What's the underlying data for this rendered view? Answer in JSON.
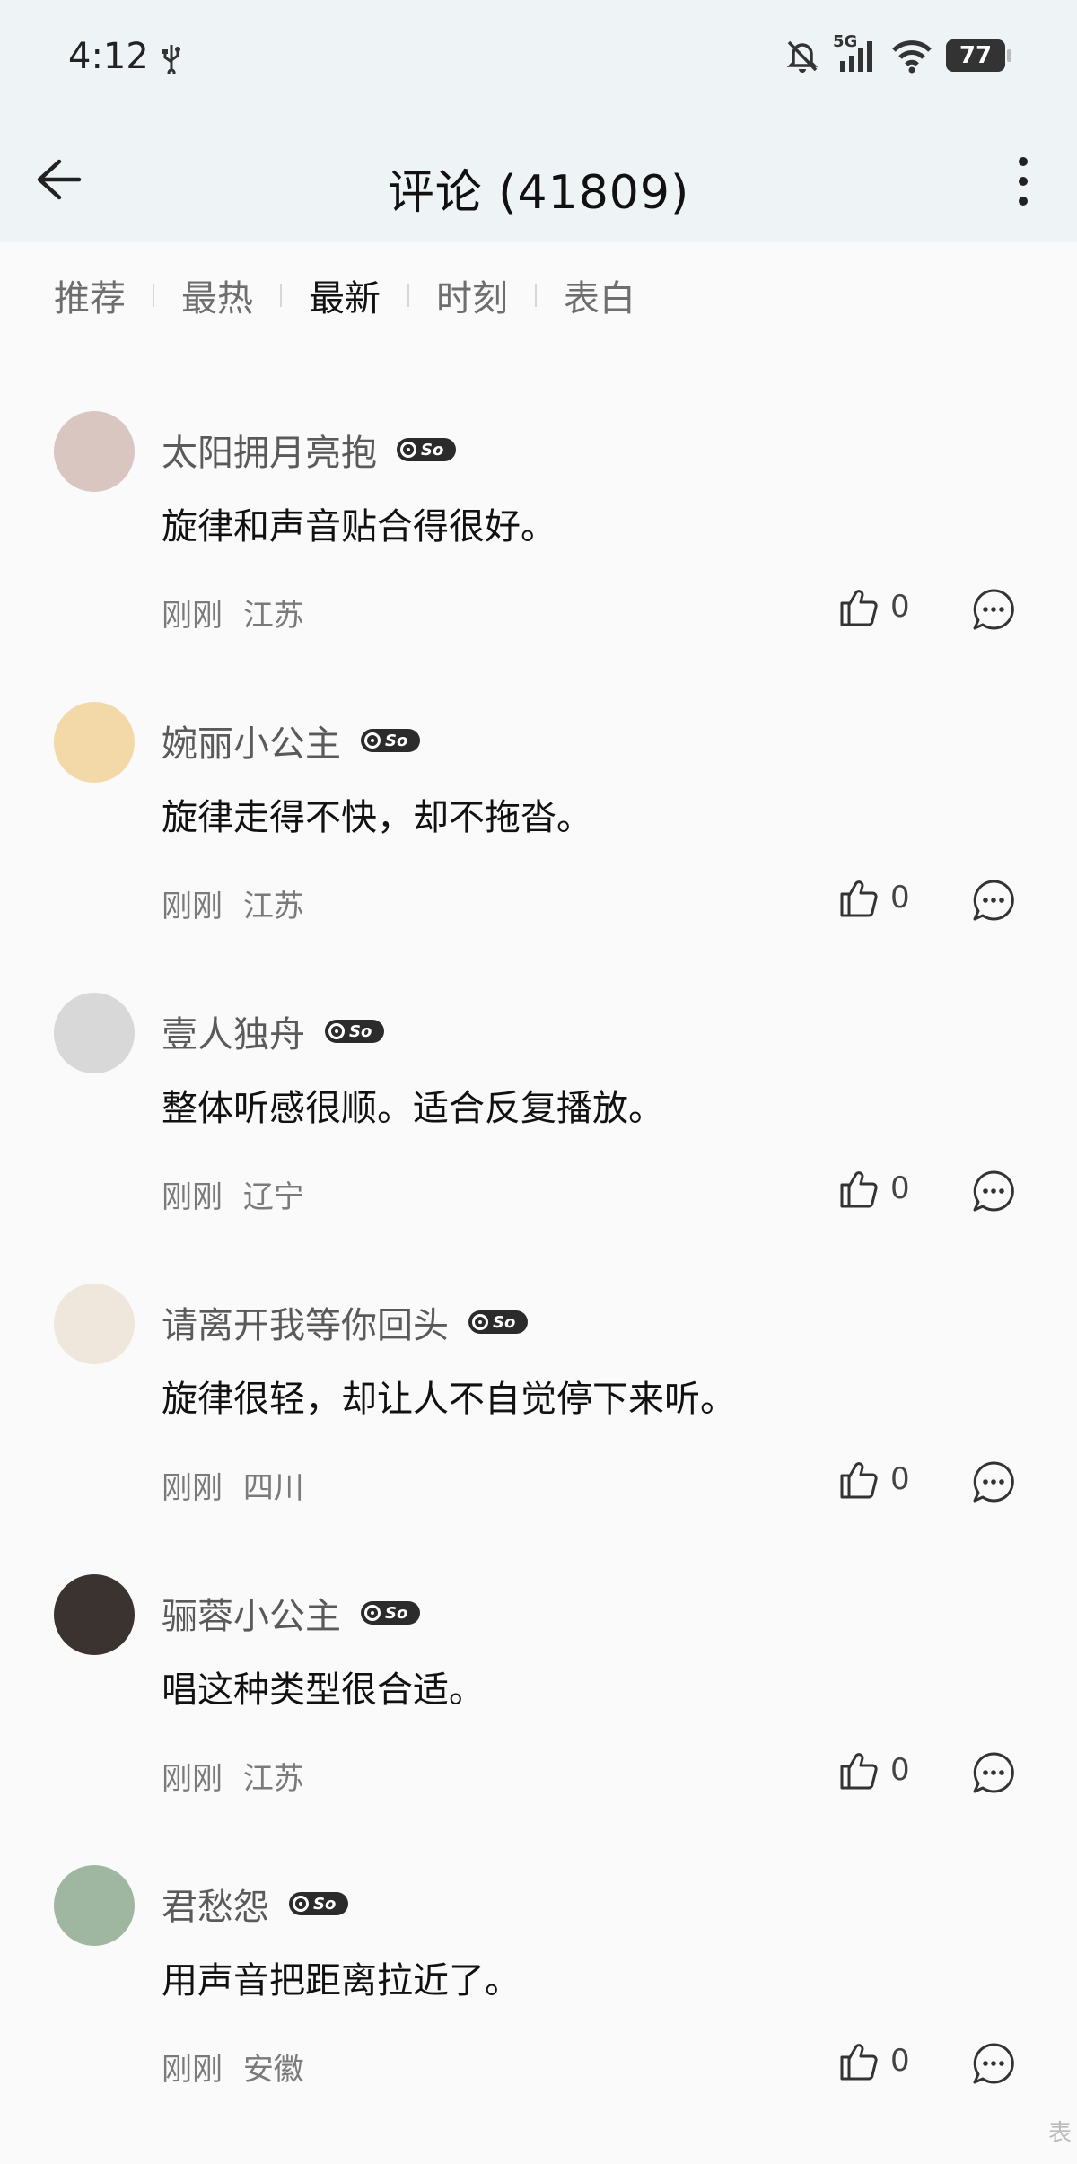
{
  "status_bar": {
    "time": "4:12",
    "network": "5G",
    "battery": "77"
  },
  "header": {
    "title": "评论 (41809)"
  },
  "tabs": [
    {
      "label": "推荐",
      "active": false
    },
    {
      "label": "最热",
      "active": false
    },
    {
      "label": "最新",
      "active": true
    },
    {
      "label": "时刻",
      "active": false
    },
    {
      "label": "表白",
      "active": false
    }
  ],
  "badge_label": "So",
  "comments": [
    {
      "user": "太阳拥月亮抱",
      "text": "旋律和声音贴合得很好。",
      "time": "刚刚",
      "location": "江苏",
      "likes": "0",
      "avatar_color": "#d9c6c0"
    },
    {
      "user": "婉丽小公主",
      "text": "旋律走得不快，却不拖沓。",
      "time": "刚刚",
      "location": "江苏",
      "likes": "0",
      "avatar_color": "#f3d8a8"
    },
    {
      "user": "壹人独舟",
      "text": "整体听感很顺。适合反复播放。",
      "time": "刚刚",
      "location": "辽宁",
      "likes": "0",
      "avatar_color": "#d8d8d8"
    },
    {
      "user": "请离开我等你回头",
      "text": "旋律很轻，却让人不自觉停下来听。",
      "time": "刚刚",
      "location": "四川",
      "likes": "0",
      "avatar_color": "#efe6dc"
    },
    {
      "user": "骊蓉小公主",
      "text": "唱这种类型很合适。",
      "time": "刚刚",
      "location": "江苏",
      "likes": "0",
      "avatar_color": "#3a3330"
    },
    {
      "user": "君愁怨",
      "text": "用声音把距离拉近了。",
      "time": "刚刚",
      "location": "安徽",
      "likes": "0",
      "avatar_color": "#9fb7a0"
    }
  ],
  "watermark": "表"
}
